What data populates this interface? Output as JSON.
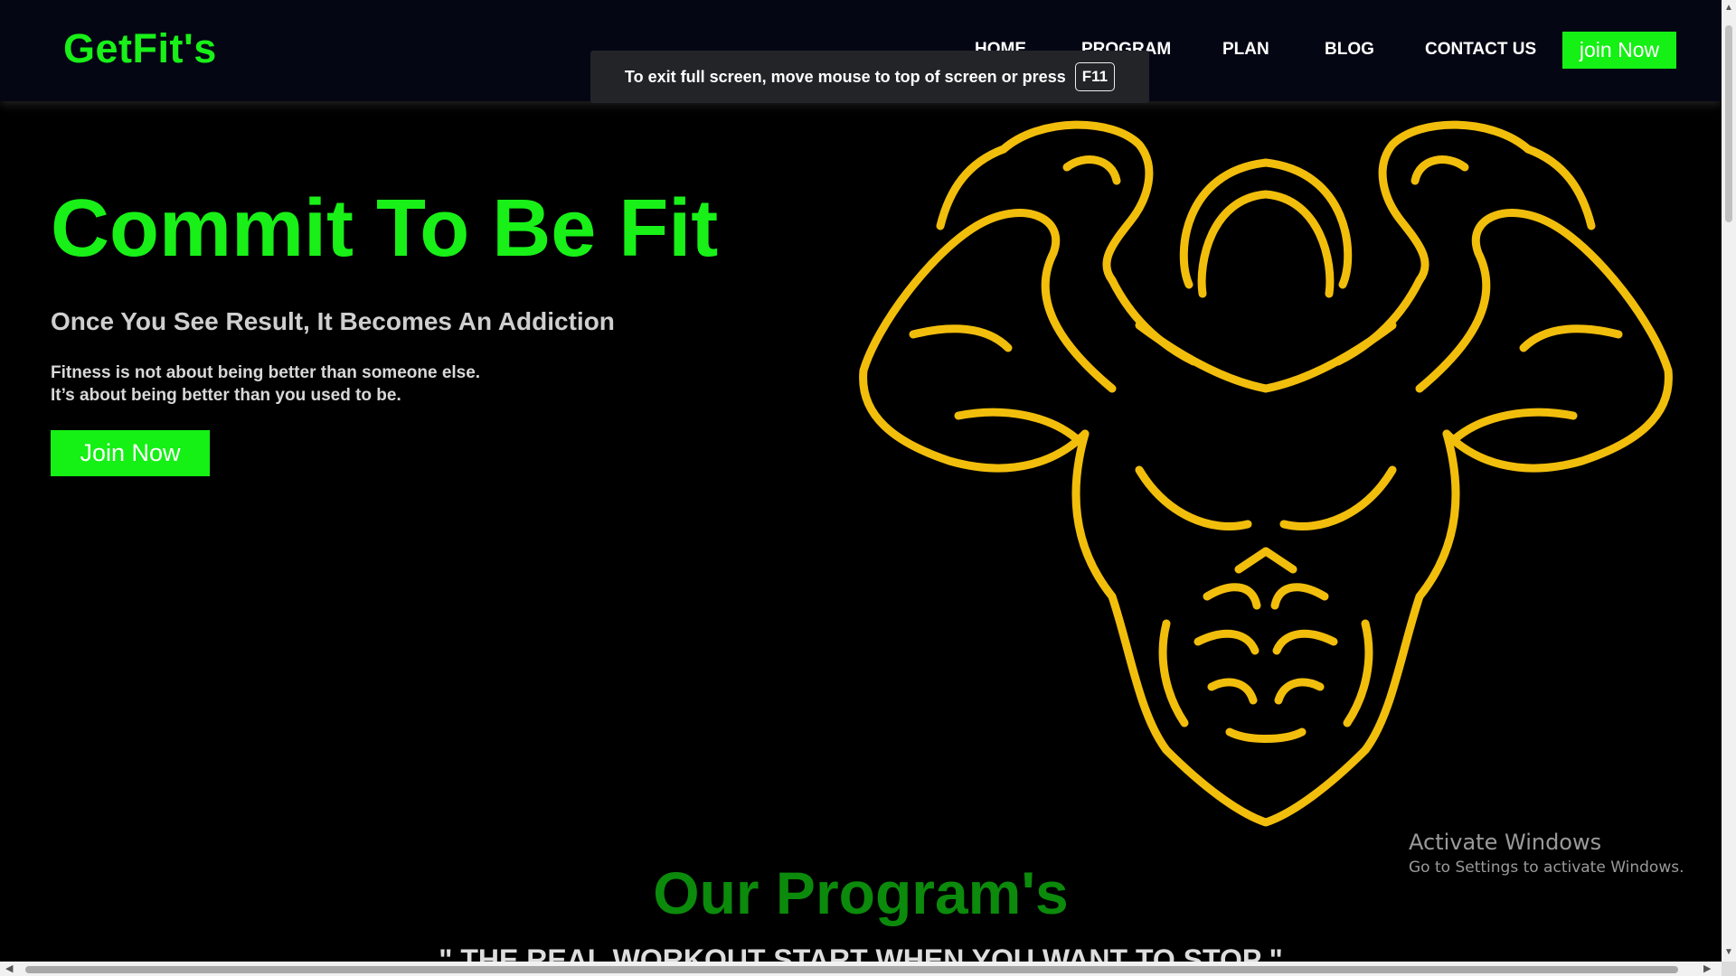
{
  "brand": {
    "logo": "GetFit's",
    "accent_color": "#18f018",
    "gold_color": "#f2be0c"
  },
  "nav": {
    "items": [
      {
        "label": "HOME"
      },
      {
        "label": "PROGRAM"
      },
      {
        "label": "PLAN"
      },
      {
        "label": "BLOG"
      },
      {
        "label": "CONTACT US"
      }
    ],
    "join_label": "join Now"
  },
  "toast": {
    "text": "To exit full screen, move mouse to top of screen or press",
    "key": "F11"
  },
  "hero": {
    "title": "Commit To Be Fit",
    "subtitle": "Once You See Result, It Becomes An Addiction",
    "text_line1": "Fitness is not about being better than someone else.",
    "text_line2": "It’s about being better than you used to be.",
    "button_label": "Join Now",
    "image_icon": "muscle-man-icon"
  },
  "programs": {
    "title": "Our Program's",
    "quote": "\" THE REAL WORKOUT START WHEN YOU WANT TO STOP \""
  },
  "watermark": {
    "line1": "Activate Windows",
    "line2": "Go to Settings to activate Windows."
  }
}
